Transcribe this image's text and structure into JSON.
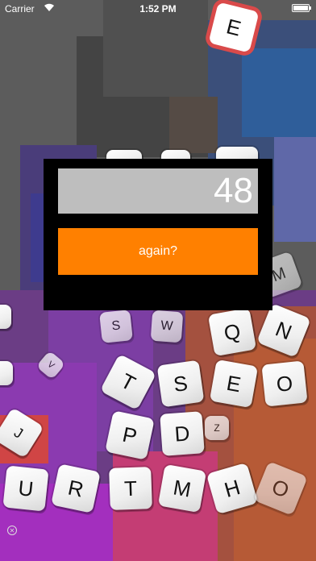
{
  "status_bar": {
    "carrier": "Carrier",
    "time": "1:52 PM"
  },
  "game": {
    "score": "48",
    "again_label": "again?"
  },
  "tiles": {
    "top_e": "E",
    "m": "M",
    "s_small": "S",
    "w_small": "W",
    "q": "Q",
    "n": "N",
    "v_small": "V",
    "t1": "T",
    "s": "S",
    "e": "E",
    "o1": "O",
    "j": "J",
    "p": "P",
    "d": "D",
    "z_small": "Z",
    "u": "U",
    "r": "R",
    "t2": "T",
    "m2": "M",
    "h": "H",
    "o2": "O"
  },
  "colors": {
    "button": "#ff8000",
    "score_box": "#bebebe",
    "dialog": "#000000"
  }
}
